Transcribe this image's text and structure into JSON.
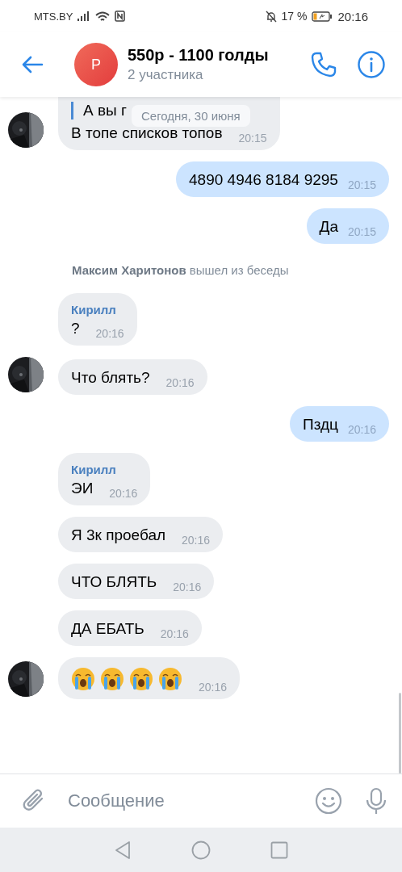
{
  "status_bar": {
    "carrier": "MTS.BY",
    "battery": "17 %",
    "time": "20:16"
  },
  "header": {
    "avatar_letter": "Р",
    "title": "550р - 1100 голды",
    "subtitle": "2 участника"
  },
  "date_pill": "Сегодня, 30 июня",
  "messages": [
    {
      "kind": "incoming",
      "quote": "А вы г",
      "text": "В топе списков топов",
      "time": "20:15",
      "avatar": true
    },
    {
      "kind": "outgoing",
      "text": "4890 4946 8184 9295",
      "time": "20:15"
    },
    {
      "kind": "outgoing",
      "text": "Да",
      "time": "20:15"
    },
    {
      "kind": "system",
      "text": "**Максим Харитонов** вышел из беседы"
    },
    {
      "kind": "incoming",
      "sender": "Кирилл",
      "text": "?",
      "time": "20:16",
      "avatar": false
    },
    {
      "kind": "incoming",
      "text": "Что блять?",
      "time": "20:16",
      "avatar": true
    },
    {
      "kind": "outgoing",
      "text": "Пздц",
      "time": "20:16"
    },
    {
      "kind": "incoming",
      "sender": "Кирилл",
      "text": "ЭИ",
      "time": "20:16",
      "avatar": false
    },
    {
      "kind": "incoming",
      "text": "Я 3к проебал",
      "time": "20:16",
      "avatar": false
    },
    {
      "kind": "incoming",
      "text": "ЧТО БЛЯТЬ",
      "time": "20:16",
      "avatar": false
    },
    {
      "kind": "incoming",
      "text": "ДА ЕБАТЬ",
      "time": "20:16",
      "avatar": false
    },
    {
      "kind": "incoming",
      "emojis": [
        {
          "kind": "loudly-crying"
        },
        {
          "kind": "loudly-crying"
        },
        {
          "kind": "loudly-crying"
        },
        {
          "kind": "loudly-crying"
        }
      ],
      "time": "20:16",
      "avatar": true
    }
  ],
  "composer": {
    "placeholder": "Сообщение"
  }
}
